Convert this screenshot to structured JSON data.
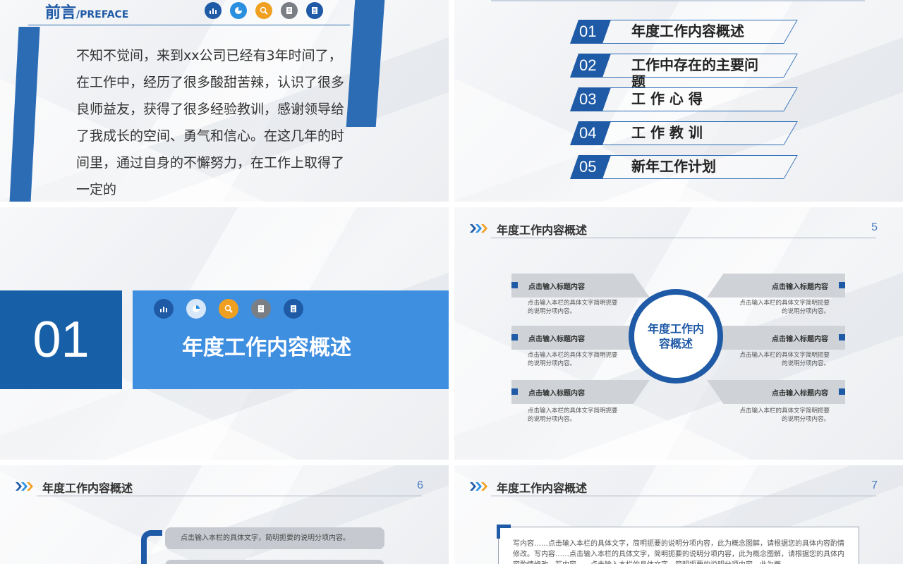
{
  "preface": {
    "title_cn": "前言",
    "title_en": "PREFACE",
    "body": "不知不觉间，来到xx公司已经有3年时间了，在工作中，经历了很多酸甜苦辣，认识了很多良师益友，获得了很多经验教训，感谢领导给了我成长的空间、勇气和信心。在这几年的时间里，通过自身的不懈努力，在工作上取得了一定的"
  },
  "icons": [
    "bar-chart-icon",
    "pie-chart-icon",
    "magnify-icon",
    "notebook-icon",
    "clipboard-icon"
  ],
  "icon_colors": [
    "#1f5aa6",
    "#2b8fe0",
    "#f0a020",
    "#7a7f86",
    "#1f5aa6"
  ],
  "toc": [
    {
      "num": "01",
      "label": "年度工作内容概述"
    },
    {
      "num": "02",
      "label": "工作中存在的主要问题"
    },
    {
      "num": "03",
      "label": "工 作 心 得"
    },
    {
      "num": "04",
      "label": "工 作 教 训"
    },
    {
      "num": "05",
      "label": "新年工作计划"
    }
  ],
  "section": {
    "num": "01",
    "title": "年度工作内容概述"
  },
  "slide5": {
    "header": "年度工作内容概述",
    "page": "5",
    "center": "年度工作内容概述",
    "card_title": "点击输入标题内容",
    "card_desc": "点击输入本栏的具体文字简明扼要的说明分项内容。"
  },
  "slide6": {
    "header": "年度工作内容概述",
    "page": "6",
    "pill_text": "点击输入本栏的具体文字，简明扼要的说明分项内容。"
  },
  "slide7": {
    "header": "年度工作内容概述",
    "page": "7",
    "body": "写内容……点击输入本栏的具体文字，简明扼要的说明分项内容，此为概念图解，请根据您的具体内容酌情修改。写内容……点击输入本栏的具体文字，简明扼要的说明分项内容，此为概念图解，请根据您的具体内容酌情修改。写内容……点击输入本栏的具体文字，简明扼要的说明分项内容，此为概"
  },
  "colors": {
    "primary": "#1f5aa6",
    "accent": "#3f8fe0",
    "orange": "#f0a020"
  }
}
